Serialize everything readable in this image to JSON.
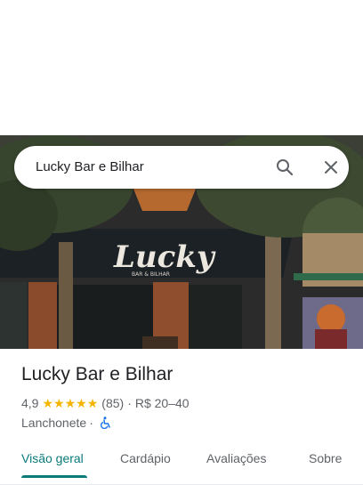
{
  "search": {
    "query": "Lucky Bar e Bilhar",
    "search_icon": "search-icon",
    "close_icon": "close-icon"
  },
  "photo": {
    "sign_text": "Lucky",
    "sign_subtext": "BAR & BILHAR"
  },
  "place": {
    "name": "Lucky Bar e Bilhar",
    "rating": "4,9",
    "stars": 5,
    "reviews": "(85)",
    "separator": "·",
    "price": "R$ 20–40",
    "category": "Lanchonete",
    "category_sep": "·",
    "accessibility_icon": "wheelchair-icon"
  },
  "tabs": [
    {
      "label": "Visão geral"
    },
    {
      "label": "Cardápio"
    },
    {
      "label": "Avaliações"
    },
    {
      "label": "Sobre"
    }
  ],
  "colors": {
    "accent": "#0b7a7a",
    "star": "#f4b400",
    "accessibility": "#1a73e8"
  }
}
